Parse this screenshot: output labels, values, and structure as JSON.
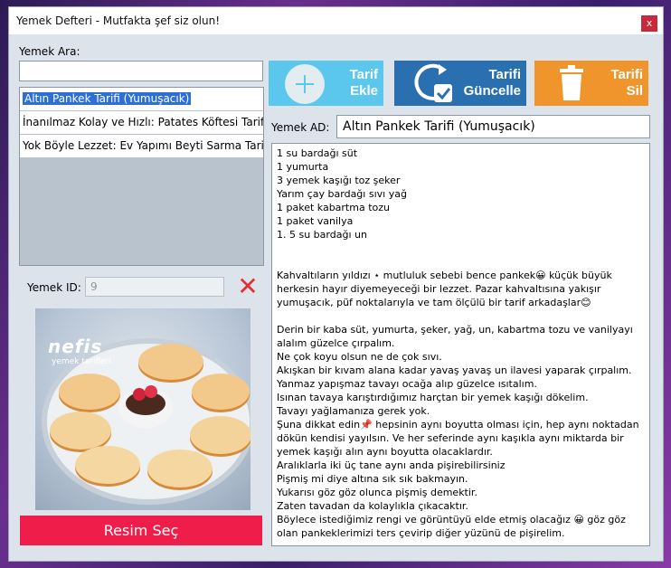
{
  "window": {
    "title": "Yemek Defteri - Mutfakta şef siz olun!",
    "close_label": "x"
  },
  "search": {
    "label": "Yemek Ara:",
    "value": ""
  },
  "recipes": [
    {
      "label": "Altın Pankek Tarifi (Yumuşacık)",
      "selected": true
    },
    {
      "label": "İnanılmaz Kolay ve Hızlı: Patates Köftesi Tarifi İ..."
    },
    {
      "label": "Yok Böyle Lezzet: Ev Yapımı Beyti Sarma Tarifi"
    }
  ],
  "id_field": {
    "label": "Yemek ID:",
    "value": "9"
  },
  "photo": {
    "brand": "nefis",
    "brand_sub": "yemek tarifleri"
  },
  "buttons": {
    "add_line1": "Tarif",
    "add_line2": "Ekle",
    "update_line1": "Tarifi",
    "update_line2": "Güncelle",
    "delete_line1": "Tarifi",
    "delete_line2": "Sil",
    "image_select": "Resim Seç"
  },
  "name_field": {
    "label": "Yemek AD:",
    "value": "Altın Pankek Tarifi (Yumuşacık)"
  },
  "recipe_text": "1 su bardağı süt\n1 yumurta\n3 yemek kaşığı toz şeker\nYarım çay bardağı sıvı yağ\n1 paket kabartma tozu\n1 paket vanilya\n1. 5 su bardağı un\n\n\nKahvaltıların yıldızı ⋆ mutluluk sebebi bence pankek😀 küçük büyük herkesin hayır diyemeyeceği bir lezzet. Pazar kahvaltısına yakışır yumuşacık, püf noktalarıyla ve tam ölçülü bir tarif arkadaşlar😊\n\nDerin bir kaba süt, yumurta, şeker, yağ, un, kabartma tozu ve vanilyayı alalım güzelce çırpalım.\nNe çok koyu olsun ne de çok sıvı.\nAkışkan bir kıvam alana kadar yavaş yavaş un ilavesi yaparak çırpalım.\nYanmaz yapışmaz tavayı ocağa alıp güzelce ısıtalım.\nIsınan tavaya karıştırdığımız harçtan bir yemek kaşığı dökelim.\nTavayı yağlamanıza gerek yok.\nŞuna dikkat edin📌 hepsinin aynı boyutta olması için, hep aynı noktadan dökün kendisi yayılsın. Ve her seferinde aynı kaşıkla aynı miktarda bir yemek kaşığı alın aynı boyutta olacaklardır.\nAralıklarla iki üç tane aynı anda pişirebilirsiniz\nPişmiş mi diye altına sık sık bakmayın.\nYukarısı göz göz olunca pişmiş demektir.\nZaten tavadan da kolaylıkla çıkacaktır.\nBöylece istediğimiz rengi ve görüntüyü elde etmiş olacağız 😀 göz göz olan pankeklerimizi ters çevirip diğer yüzünü de pişirelim."
}
